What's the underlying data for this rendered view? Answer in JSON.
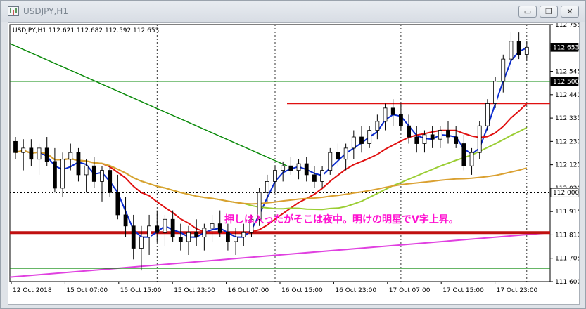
{
  "window": {
    "title": "USDJPY,H1",
    "controls": {
      "minimize": "▭",
      "restore": "❐",
      "close": "✕"
    }
  },
  "chart": {
    "info": "USDJPY,H1  112.621 112.682 112.592 112.653",
    "annotation": "押しは入ったがそこは夜中。明けの明星でV字上昇。",
    "current_price_label": "112.653",
    "marked_prices": [
      "112.500",
      "112.000"
    ]
  },
  "colors": {
    "candle": "#000000",
    "ma_fast": "#0a2bd0",
    "ma_mid": "#e01010",
    "ma_slow": "#9acd32",
    "ma_long": "#daa030",
    "trend_green": "#0a8a0a",
    "trend_magenta": "#e040e0",
    "support_red": "#c01010",
    "annotation": "#ff10d0"
  },
  "chart_data": {
    "type": "candlestick",
    "symbol": "USDJPY",
    "timeframe": "H1",
    "ohlc_last": {
      "open": 112.621,
      "high": 112.682,
      "low": 112.592,
      "close": 112.653
    },
    "y_ticks": [
      "112.755",
      "112.650",
      "112.545",
      "112.440",
      "112.335",
      "112.230",
      "112.125",
      "112.020",
      "111.915",
      "111.810",
      "111.705",
      "111.600"
    ],
    "ylim": [
      111.6,
      112.755
    ],
    "x_ticks": [
      "12 Oct 2018",
      "15 Oct 07:00",
      "15 Oct 15:00",
      "15 Oct 23:00",
      "16 Oct 07:00",
      "16 Oct 15:00",
      "16 Oct 23:00",
      "17 Oct 07:00",
      "17 Oct 15:00",
      "17 Oct 23:00"
    ],
    "horizontal_levels": [
      {
        "price": 112.5,
        "label": "112.500",
        "color": "#0a8a0a"
      },
      {
        "price": 112.4,
        "color": "#e01010"
      },
      {
        "price": 112.0,
        "label": "112.000",
        "style": "dotted"
      },
      {
        "price": 111.82,
        "color": "#c01010",
        "thick": true
      },
      {
        "price": 111.66,
        "color": "#0a8a0a"
      }
    ],
    "candles": [
      [
        112.23,
        112.25,
        112.15,
        112.18
      ],
      [
        112.18,
        112.24,
        112.1,
        112.2
      ],
      [
        112.2,
        112.24,
        112.12,
        112.15
      ],
      [
        112.15,
        112.22,
        112.08,
        112.2
      ],
      [
        112.2,
        112.25,
        112.12,
        112.14
      ],
      [
        112.14,
        112.2,
        112.0,
        112.02
      ],
      [
        112.02,
        112.18,
        111.98,
        112.15
      ],
      [
        112.15,
        112.22,
        112.1,
        112.18
      ],
      [
        112.18,
        112.2,
        112.05,
        112.08
      ],
      [
        112.08,
        112.15,
        112.0,
        112.12
      ],
      [
        112.12,
        112.16,
        112.02,
        112.05
      ],
      [
        112.05,
        112.12,
        111.96,
        112.1
      ],
      [
        112.1,
        112.12,
        111.98,
        112.0
      ],
      [
        112.0,
        112.08,
        111.88,
        111.9
      ],
      [
        111.9,
        111.98,
        111.8,
        111.85
      ],
      [
        111.85,
        111.9,
        111.7,
        111.75
      ],
      [
        111.75,
        111.85,
        111.65,
        111.8
      ],
      [
        111.8,
        111.9,
        111.72,
        111.85
      ],
      [
        111.85,
        111.92,
        111.78,
        111.82
      ],
      [
        111.82,
        111.9,
        111.76,
        111.88
      ],
      [
        111.88,
        111.92,
        111.78,
        111.8
      ],
      [
        111.8,
        111.86,
        111.74,
        111.78
      ],
      [
        111.78,
        111.85,
        111.72,
        111.82
      ],
      [
        111.82,
        111.88,
        111.76,
        111.8
      ],
      [
        111.8,
        111.86,
        111.74,
        111.84
      ],
      [
        111.84,
        111.9,
        111.78,
        111.86
      ],
      [
        111.86,
        111.92,
        111.8,
        111.82
      ],
      [
        111.82,
        111.86,
        111.74,
        111.78
      ],
      [
        111.78,
        111.84,
        111.72,
        111.8
      ],
      [
        111.8,
        111.86,
        111.76,
        111.82
      ],
      [
        111.82,
        111.9,
        111.8,
        111.88
      ],
      [
        111.88,
        112.02,
        111.85,
        112.0
      ],
      [
        112.0,
        112.08,
        111.96,
        112.05
      ],
      [
        112.05,
        112.12,
        112.0,
        112.1
      ],
      [
        112.1,
        112.14,
        112.05,
        112.12
      ],
      [
        112.12,
        112.16,
        112.08,
        112.1
      ],
      [
        112.1,
        112.15,
        112.06,
        112.13
      ],
      [
        112.13,
        112.16,
        112.05,
        112.08
      ],
      [
        112.08,
        112.12,
        112.02,
        112.05
      ],
      [
        112.05,
        112.12,
        112.02,
        112.1
      ],
      [
        112.1,
        112.2,
        112.08,
        112.18
      ],
      [
        112.18,
        112.22,
        112.12,
        112.15
      ],
      [
        112.15,
        112.22,
        112.1,
        112.2
      ],
      [
        112.2,
        112.28,
        112.15,
        112.25
      ],
      [
        112.25,
        112.3,
        112.18,
        112.22
      ],
      [
        112.22,
        112.3,
        112.2,
        112.28
      ],
      [
        112.28,
        112.35,
        112.24,
        112.32
      ],
      [
        112.32,
        112.4,
        112.28,
        112.38
      ],
      [
        112.38,
        112.42,
        112.3,
        112.35
      ],
      [
        112.35,
        112.4,
        112.28,
        112.3
      ],
      [
        112.3,
        112.35,
        112.22,
        112.25
      ],
      [
        112.25,
        112.3,
        112.18,
        112.22
      ],
      [
        112.22,
        112.28,
        112.18,
        112.26
      ],
      [
        112.26,
        112.3,
        112.2,
        112.24
      ],
      [
        112.24,
        112.3,
        112.2,
        112.28
      ],
      [
        112.28,
        112.32,
        112.22,
        112.25
      ],
      [
        112.25,
        112.3,
        112.2,
        112.22
      ],
      [
        112.22,
        112.26,
        112.1,
        112.12
      ],
      [
        112.12,
        112.2,
        112.08,
        112.18
      ],
      [
        112.18,
        112.32,
        112.15,
        112.3
      ],
      [
        112.3,
        112.42,
        112.28,
        112.4
      ],
      [
        112.4,
        112.52,
        112.38,
        112.5
      ],
      [
        112.5,
        112.62,
        112.45,
        112.6
      ],
      [
        112.6,
        112.72,
        112.55,
        112.68
      ],
      [
        112.68,
        112.72,
        112.6,
        112.62
      ],
      [
        112.621,
        112.682,
        112.592,
        112.653
      ]
    ],
    "indicators": [
      {
        "name": "MA fast",
        "color": "#0a2bd0"
      },
      {
        "name": "MA mid",
        "color": "#e01010"
      },
      {
        "name": "MA slow",
        "color": "#9acd32"
      },
      {
        "name": "MA long",
        "color": "#daa030"
      }
    ]
  }
}
